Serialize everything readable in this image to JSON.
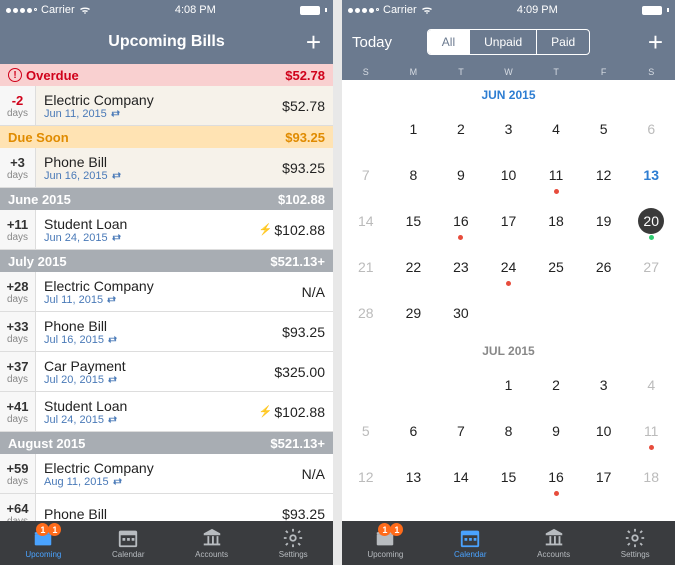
{
  "left": {
    "statusbar": {
      "carrier": "Carrier",
      "time": "4:08 PM",
      "wifi_icon": "wifi-icon",
      "battery_icon": "battery-icon"
    },
    "nav": {
      "title": "Upcoming Bills",
      "add": "+"
    },
    "sections": [
      {
        "id": "overdue",
        "label": "Overdue",
        "total": "$52.78",
        "style": "sh-overdue",
        "rows": [
          {
            "days": "-2",
            "unit": "days",
            "name": "Electric Company",
            "date": "Jun 11, 2015",
            "amount": "$52.78",
            "tint": true,
            "red": true
          }
        ]
      },
      {
        "id": "duesoon",
        "label": "Due Soon",
        "total": "$93.25",
        "style": "sh-duesoon",
        "rows": [
          {
            "days": "+3",
            "unit": "days",
            "name": "Phone Bill",
            "date": "Jun 16, 2015",
            "amount": "$93.25",
            "tint": true
          }
        ]
      },
      {
        "id": "jun",
        "label": "June 2015",
        "total": "$102.88",
        "style": "sh-month",
        "rows": [
          {
            "days": "+11",
            "unit": "days",
            "name": "Student Loan",
            "date": "Jun 24, 2015",
            "amount": "$102.88",
            "bolt": true
          }
        ]
      },
      {
        "id": "jul",
        "label": "July 2015",
        "total": "$521.13+",
        "style": "sh-month",
        "rows": [
          {
            "days": "+28",
            "unit": "days",
            "name": "Electric Company",
            "date": "Jul 11, 2015",
            "amount": "N/A"
          },
          {
            "days": "+33",
            "unit": "days",
            "name": "Phone Bill",
            "date": "Jul 16, 2015",
            "amount": "$93.25"
          },
          {
            "days": "+37",
            "unit": "days",
            "name": "Car Payment",
            "date": "Jul 20, 2015",
            "amount": "$325.00"
          },
          {
            "days": "+41",
            "unit": "days",
            "name": "Student Loan",
            "date": "Jul 24, 2015",
            "amount": "$102.88",
            "bolt": true
          }
        ]
      },
      {
        "id": "aug",
        "label": "August 2015",
        "total": "$521.13+",
        "style": "sh-month",
        "rows": [
          {
            "days": "+59",
            "unit": "days",
            "name": "Electric Company",
            "date": "Aug 11, 2015",
            "amount": "N/A"
          },
          {
            "days": "+64",
            "unit": "days",
            "name": "Phone Bill",
            "date": "",
            "amount": "$93.25"
          }
        ]
      }
    ],
    "tabs": {
      "badges": [
        "1",
        "1"
      ],
      "active": 0
    }
  },
  "right": {
    "statusbar": {
      "carrier": "Carrier",
      "time": "4:09 PM"
    },
    "nav": {
      "today": "Today",
      "seg": [
        "All",
        "Unpaid",
        "Paid"
      ],
      "seg_active": 0,
      "add": "+"
    },
    "weekdays": [
      "S",
      "M",
      "T",
      "W",
      "T",
      "F",
      "S"
    ],
    "months": [
      {
        "label": "JUN 2015",
        "gray": false,
        "weeks": [
          [
            {
              "d": "",
              "we": true
            },
            {
              "d": "1"
            },
            {
              "d": "2"
            },
            {
              "d": "3"
            },
            {
              "d": "4"
            },
            {
              "d": "5"
            },
            {
              "d": "6",
              "we": true
            }
          ],
          [
            {
              "d": "7",
              "we": true
            },
            {
              "d": "8"
            },
            {
              "d": "9"
            },
            {
              "d": "10"
            },
            {
              "d": "11",
              "m": "red"
            },
            {
              "d": "12"
            },
            {
              "d": "13",
              "blue": true
            }
          ],
          [
            {
              "d": "14",
              "we": true
            },
            {
              "d": "15"
            },
            {
              "d": "16",
              "m": "red"
            },
            {
              "d": "17"
            },
            {
              "d": "18"
            },
            {
              "d": "19"
            },
            {
              "d": "20",
              "sel": true,
              "m": "green"
            }
          ],
          [
            {
              "d": "21",
              "we": true
            },
            {
              "d": "22"
            },
            {
              "d": "23"
            },
            {
              "d": "24",
              "m": "red"
            },
            {
              "d": "25"
            },
            {
              "d": "26"
            },
            {
              "d": "27",
              "we": true
            }
          ],
          [
            {
              "d": "28",
              "we": true
            },
            {
              "d": "29"
            },
            {
              "d": "30"
            },
            {
              "d": ""
            },
            {
              "d": ""
            },
            {
              "d": ""
            },
            {
              "d": ""
            }
          ]
        ]
      },
      {
        "label": "JUL 2015",
        "gray": true,
        "weeks": [
          [
            {
              "d": "",
              "we": true
            },
            {
              "d": ""
            },
            {
              "d": ""
            },
            {
              "d": "1"
            },
            {
              "d": "2"
            },
            {
              "d": "3"
            },
            {
              "d": "4",
              "we": true
            }
          ],
          [
            {
              "d": "5",
              "we": true
            },
            {
              "d": "6"
            },
            {
              "d": "7"
            },
            {
              "d": "8"
            },
            {
              "d": "9"
            },
            {
              "d": "10"
            },
            {
              "d": "11",
              "we": true,
              "m": "red"
            }
          ],
          [
            {
              "d": "12",
              "we": true
            },
            {
              "d": "13"
            },
            {
              "d": "14"
            },
            {
              "d": "15"
            },
            {
              "d": "16",
              "m": "red"
            },
            {
              "d": "17"
            },
            {
              "d": "18",
              "we": true
            }
          ]
        ]
      }
    ],
    "tabs": {
      "badges": [
        "1",
        "1"
      ],
      "active": 1
    }
  },
  "tab_labels": [
    "Upcoming",
    "Calendar",
    "Accounts",
    "Settings"
  ]
}
